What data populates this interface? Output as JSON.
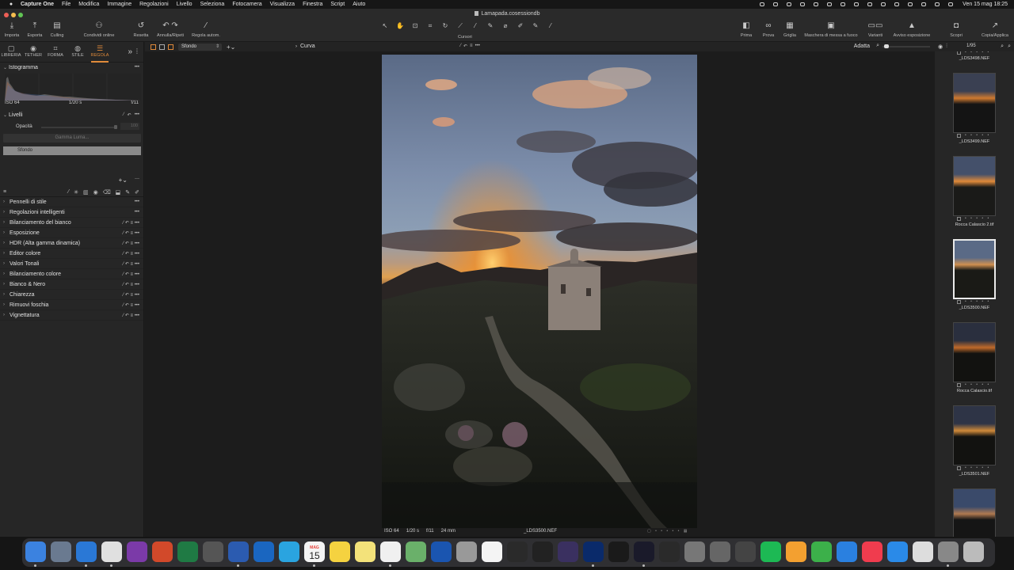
{
  "menubar": {
    "app_name": "Capture One",
    "items": [
      "File",
      "Modifica",
      "Immagine",
      "Regolazioni",
      "Livello",
      "Seleziona",
      "Fotocamera",
      "Visualizza",
      "Finestra",
      "Script",
      "Aiuto"
    ],
    "clock": "Ven 15 mag  18:25"
  },
  "window": {
    "title": "Lamapada.cosessiondb"
  },
  "toolbar": {
    "importa": "Importa",
    "esporta": "Esporta",
    "culling": "Culling",
    "condividi": "Condividi online",
    "resetta": "Resetta",
    "annulla": "Annulla/Ripeti",
    "regola_autom": "Regola autom.",
    "cursori": "Cursori",
    "prima": "Prima",
    "prova": "Prova",
    "griglia": "Griglia",
    "maschera": "Maschera di messa a fuoco",
    "varianti": "Varianti",
    "avviso": "Avviso esposizione",
    "scopri": "Scopri",
    "copia": "Copia/Applica"
  },
  "tool_tabs": [
    {
      "label": "LIBRERIA",
      "icon": "library-icon"
    },
    {
      "label": "TETHER",
      "icon": "tether-icon"
    },
    {
      "label": "FORMA",
      "icon": "crop-icon"
    },
    {
      "label": "STILE",
      "icon": "style-icon"
    },
    {
      "label": "REGOLA",
      "icon": "adjust-icon",
      "active": true
    }
  ],
  "histogram": {
    "title": "Istogramma",
    "iso": "ISO 64",
    "shutter": "1/20 s",
    "aperture": "f/11"
  },
  "levels": {
    "title": "Livelli",
    "opacity_label": "Opacità",
    "opacity_value": "100",
    "gamma_button": "Gamma Luma...",
    "layer_name": "Sfondo"
  },
  "tools": [
    "Pennelli di stile",
    "Regolazioni intelligenti",
    "Bilanciamento del bianco",
    "Esposizione",
    "HDR (Alta gamma dinamica)",
    "Editor colore",
    "Valori Tonali",
    "Bilanciamento colore",
    "Bianco & Nero",
    "Chiarezza",
    "Rimuovi foschia",
    "Vignettatura"
  ],
  "viewer": {
    "layer_select": "Sfondo",
    "curve_title": "Curva",
    "fit_label": "Adatta",
    "info": {
      "iso": "ISO 64",
      "shutter": "1/20 s",
      "aperture": "f/11",
      "focal": "24 mm"
    },
    "filename": "_LDS3500.NEF"
  },
  "browser": {
    "count": "1/95",
    "thumbnails": [
      {
        "name": "_LDS3498.NEF"
      },
      {
        "name": "_LDS3499.NEF"
      },
      {
        "name": "Rocca Calascio 2.tif"
      },
      {
        "name": "_LDS3500.NEF",
        "selected": true
      },
      {
        "name": "Rocca Calascio.tif"
      },
      {
        "name": "_LDS3501.NEF"
      },
      {
        "name": ""
      }
    ]
  },
  "dock": {
    "calendar_month": "MAG",
    "calendar_day": "15",
    "apps": [
      "Finder",
      "Launchpad",
      "Safari",
      "Chrome",
      "OneNote",
      "PowerPoint",
      "Excel",
      "Calculator",
      "Word",
      "Outlook",
      "Telegram",
      "Calendar",
      "Notes",
      "Stickies",
      "Reminders",
      "Maps",
      "SketchUp",
      "Pro",
      "Photos",
      "Affinity",
      "XD pen",
      "Affinity Photo",
      "Photoshop",
      "1Password",
      "DaVinci Resolve",
      "Final Cut Pro",
      "Compressor",
      "Disk Utility",
      "Calculator2",
      "Spotify",
      "Pages",
      "Numbers",
      "Keynote",
      "Music",
      "App Store",
      "Preview",
      "System Settings",
      "Trash"
    ]
  }
}
